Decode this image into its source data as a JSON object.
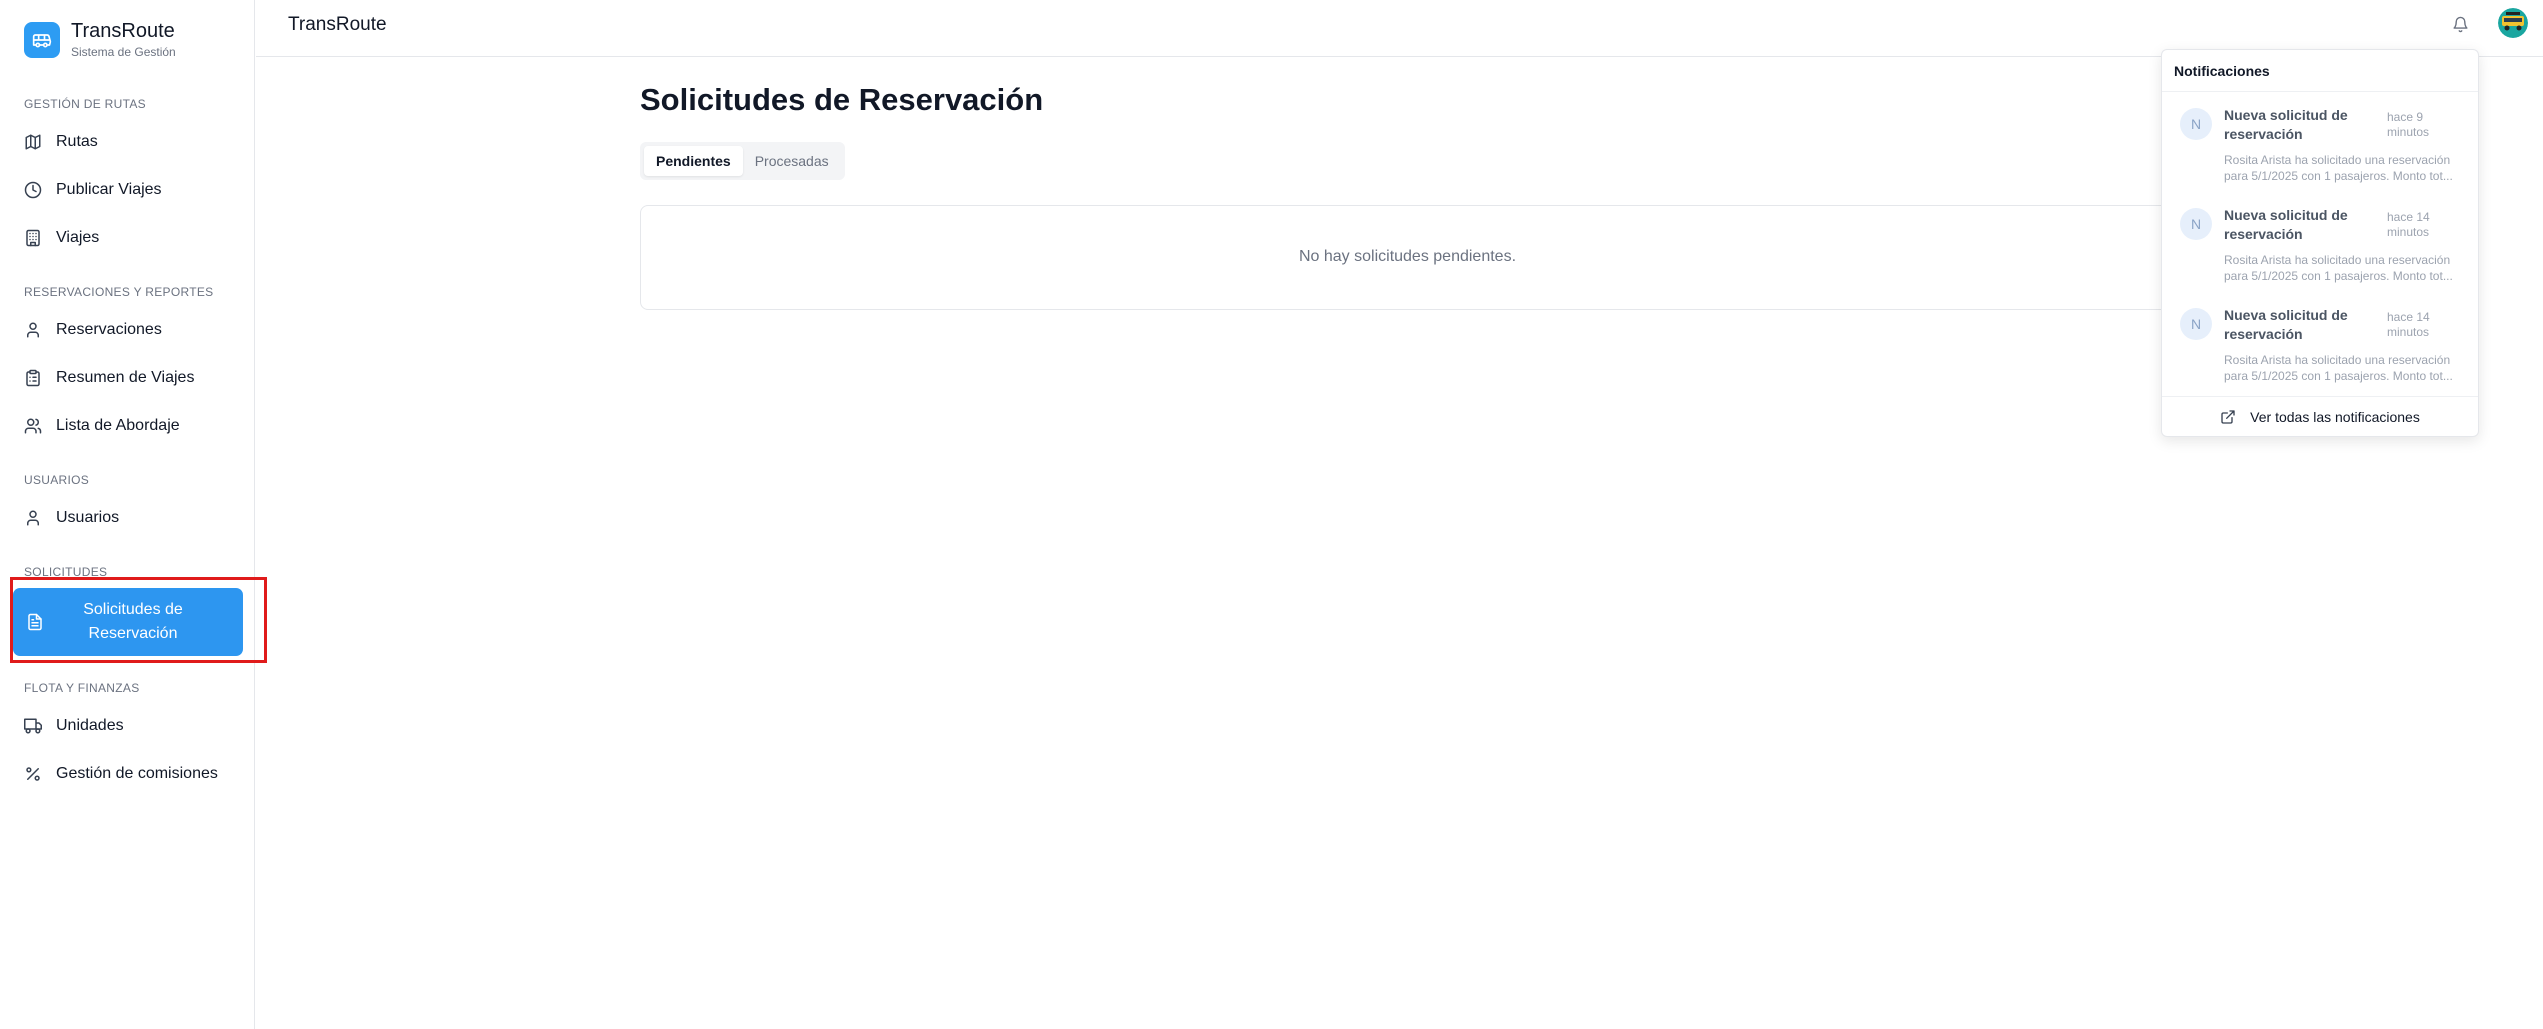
{
  "app": {
    "name": "TransRoute",
    "subtitle": "Sistema de Gestión",
    "accent_color": "#2d96f0"
  },
  "sidebar": {
    "sections": [
      {
        "label": "GESTIÓN DE RUTAS"
      },
      {
        "label": "RESERVACIONES Y REPORTES"
      },
      {
        "label": "USUARIOS"
      },
      {
        "label": "SOLICITUDES"
      },
      {
        "label": "FLOTA Y FINANZAS"
      }
    ],
    "items": [
      {
        "label": "Rutas",
        "icon": "map-icon"
      },
      {
        "label": "Publicar Viajes",
        "icon": "clock-icon"
      },
      {
        "label": "Viajes",
        "icon": "building-icon"
      },
      {
        "label": "Reservaciones",
        "icon": "user-icon"
      },
      {
        "label": "Resumen de Viajes",
        "icon": "clipboard-icon"
      },
      {
        "label": "Lista de Abordaje",
        "icon": "users-icon"
      },
      {
        "label": "Usuarios",
        "icon": "user-icon"
      },
      {
        "label": "Solicitudes de Reservación",
        "icon": "file-text-icon",
        "active": true
      },
      {
        "label": "Unidades",
        "icon": "truck-icon"
      },
      {
        "label": "Gestión de comisiones",
        "icon": "percent-icon"
      }
    ]
  },
  "header": {
    "title": "TransRoute"
  },
  "main": {
    "title": "Solicitudes de Reservación",
    "tabs": [
      {
        "label": "Pendientes",
        "active": true
      },
      {
        "label": "Procesadas",
        "active": false
      }
    ],
    "empty_message": "No hay solicitudes pendientes."
  },
  "notifications": {
    "title": "Notificaciones",
    "items": [
      {
        "avatar_letter": "N",
        "title": "Nueva solicitud de reservación",
        "time": "hace 9 minutos",
        "body": "Rosita Arista ha solicitado una reservación para 5/1/2025 con 1 pasajeros. Monto tot..."
      },
      {
        "avatar_letter": "N",
        "title": "Nueva solicitud de reservación",
        "time": "hace 14 minutos",
        "body": "Rosita Arista ha solicitado una reservación para 5/1/2025 con 1 pasajeros. Monto tot..."
      },
      {
        "avatar_letter": "N",
        "title": "Nueva solicitud de reservación",
        "time": "hace 14 minutos",
        "body": "Rosita Arista ha solicitado una reservación para 5/1/2025 con 1 pasajeros. Monto tot..."
      }
    ],
    "view_all_label": "Ver todas las notificaciones"
  }
}
